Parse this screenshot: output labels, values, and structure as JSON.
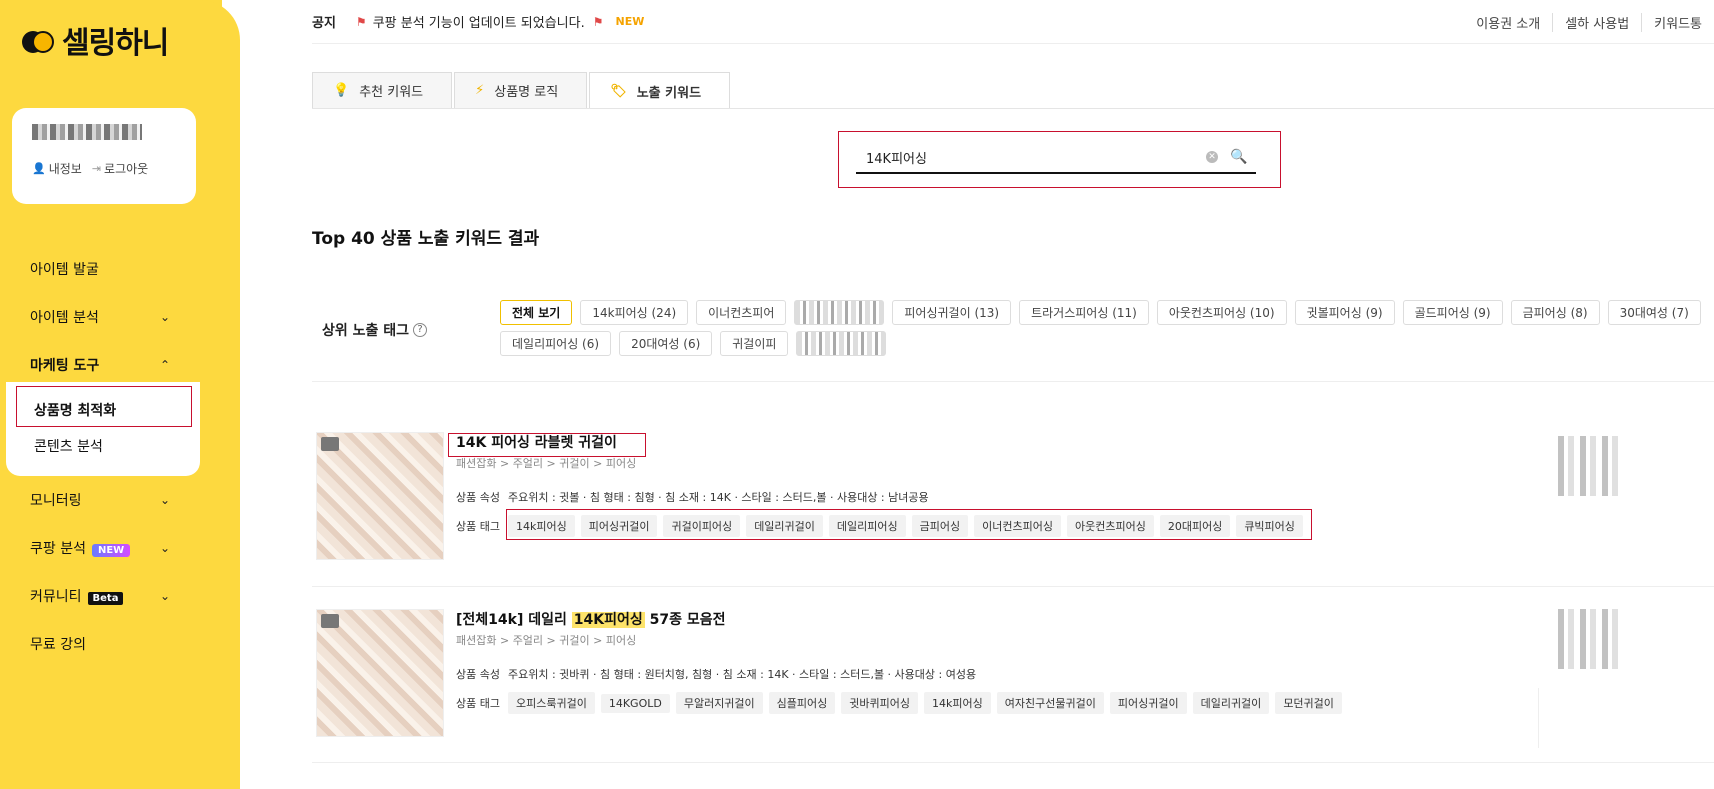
{
  "brand": {
    "name": "셀링하니"
  },
  "user": {
    "info_label": "내정보",
    "logout_label": "로그아웃"
  },
  "nav": {
    "item_discovery": "아이템 발굴",
    "item_analysis": "아이템 분석",
    "marketing": "마케팅 도구",
    "sub_title_opt": "상품명 최적화",
    "sub_content": "콘텐츠 분석",
    "monitoring": "모니터링",
    "coupang": "쿠팡 분석",
    "coupang_badge": "NEW",
    "community": "커뮤니티",
    "community_badge": "Beta",
    "free_lecture": "무료 강의"
  },
  "topbar": {
    "notice_label": "공지",
    "notice_text": "쿠팡 분석 기능이 업데이트 되었습니다.",
    "new_label": "NEW",
    "links": [
      "이용권 소개",
      "셀하 사용법",
      "키워드통"
    ]
  },
  "tabs": [
    "추천 키워드",
    "상품명 로직",
    "노출 키워드"
  ],
  "search": {
    "value": "14K피어싱"
  },
  "result_title": "Top 40 상품 노출 키워드 결과",
  "tag_filter": {
    "label": "상위 노출 태그",
    "tags": [
      {
        "text": "전체 보기",
        "state": "active"
      },
      {
        "text": "14k피어싱 (24)",
        "state": "normal"
      },
      {
        "text": "이너컨츠피어",
        "state": "normal"
      },
      {
        "text": "",
        "state": "blur"
      },
      {
        "text": "피어싱귀걸이 (13)",
        "state": "normal"
      },
      {
        "text": "트라거스피어싱 (11)",
        "state": "normal"
      },
      {
        "text": "아웃컨츠피어싱 (10)",
        "state": "normal"
      },
      {
        "text": "귓볼피어싱 (9)",
        "state": "normal"
      },
      {
        "text": "골드피어싱 (9)",
        "state": "normal"
      },
      {
        "text": "금피어싱 (8)",
        "state": "normal"
      },
      {
        "text": "30대여성 (7)",
        "state": "normal"
      },
      {
        "text": "데일리피어싱 (6)",
        "state": "normal"
      },
      {
        "text": "20대여성 (6)",
        "state": "normal"
      },
      {
        "text": "귀걸이피",
        "state": "normal"
      },
      {
        "text": "",
        "state": "blur"
      }
    ]
  },
  "products": [
    {
      "title": "14K 피어싱 라블렛 귀걸이",
      "category": "패션잡화 > 주얼리 > 귀걸이 > 피어싱",
      "attr_label": "상품 속성",
      "attrs": "주요위치 : 귓볼 · 침 형태 : 침형 · 침 소재 : 14K · 스타일 : 스터드,볼 · 사용대상 : 남녀공용",
      "tags_label": "상품 태그",
      "tags": [
        "14k피어싱",
        "피어싱귀걸이",
        "귀걸이피어싱",
        "데일리귀걸이",
        "데일리피어싱",
        "금피어싱",
        "이너컨츠피어싱",
        "아웃컨츠피어싱",
        "20대피어싱",
        "큐빅피어싱"
      ]
    },
    {
      "title_pre": "[전체14k] 데일리 ",
      "title_hl": "14K피어싱",
      "title_post": " 57종 모음전",
      "category": "패션잡화 > 주얼리 > 귀걸이 > 피어싱",
      "attr_label": "상품 속성",
      "attrs": "주요위치 : 귓바퀴 · 침 형태 : 원터치형, 침형 · 침 소재 : 14K · 스타일 : 스터드,볼 · 사용대상 : 여성용",
      "tags_label": "상품 태그",
      "tags": [
        "오피스룩귀걸이",
        "14KGOLD",
        "무알러지귀걸이",
        "심플피어싱",
        "귓바퀴피어싱",
        "14k피어싱",
        "여자친구선물귀걸이",
        "피어싱귀걸이",
        "데일리귀걸이",
        "모던귀걸이"
      ]
    }
  ],
  "colors": {
    "brand_yellow": "#fdd93f",
    "highlight_red": "#c8102e",
    "accent_orange": "#f5a300"
  }
}
